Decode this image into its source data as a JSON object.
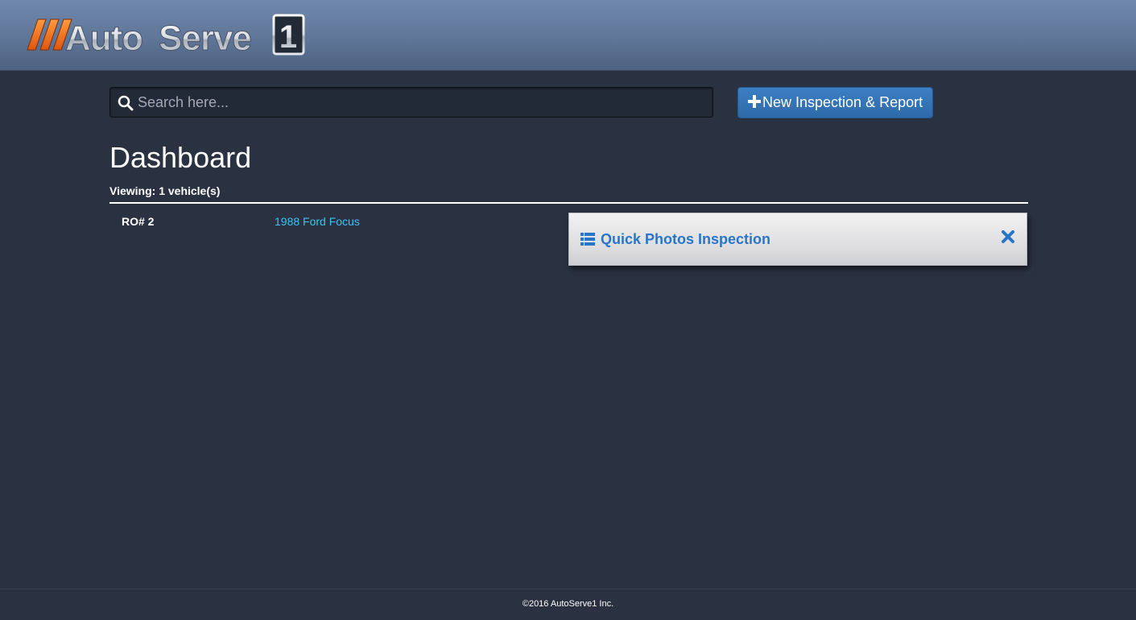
{
  "header": {
    "logo_text": "Auto Serve 1",
    "logo_colors": {
      "stripes": "#f26f1c",
      "text": "#d9dde3"
    }
  },
  "search": {
    "placeholder": "Search here...",
    "value": "",
    "icon": "search-icon"
  },
  "toolbar": {
    "new_button_label": "New Inspection & Report",
    "new_button_icon": "plus-icon",
    "accent": "#2e6aa9"
  },
  "page": {
    "title": "Dashboard",
    "viewing_text": "Viewing: 1 vehicle(s)"
  },
  "vehicles": [
    {
      "ro": "RO# 2",
      "vehicle": "1988 Ford Focus"
    }
  ],
  "popup": {
    "title": "Quick Photos Inspection",
    "icon": "list-icon",
    "close_icon": "close-icon",
    "title_color": "#2a76c6"
  },
  "footer": {
    "copyright": "©2016 AutoServe1 Inc."
  }
}
